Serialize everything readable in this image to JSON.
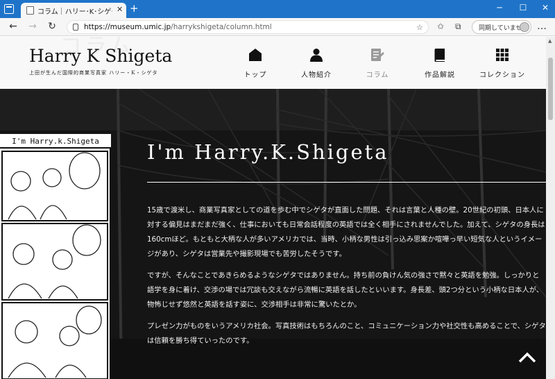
{
  "browser": {
    "tab_title": "コラム｜ハリー･K･シゲタ Harry K Shigeta",
    "tab_close": "✕",
    "new_tab": "+",
    "window_controls": {
      "minimize": "─",
      "maximize": "☐",
      "close": "✕"
    },
    "nav": {
      "back": "←",
      "forward": "→",
      "reload": "↻"
    },
    "url_host": "https://museum.umic.jp",
    "url_path": "/harrykshigeta/column.html",
    "sync_label": "同期していません",
    "more": "…"
  },
  "site": {
    "bg_word": "コラム",
    "logo": "Harry K Shigeta",
    "logo_sub": "上田が生んだ国際的商業写真家 ハリー・K・シゲタ",
    "nav": [
      {
        "label": "トップ",
        "icon": "home-icon"
      },
      {
        "label": "人物紹介",
        "icon": "person-icon"
      },
      {
        "label": "コラム",
        "icon": "edit-note-icon",
        "active": true
      },
      {
        "label": "作品解説",
        "icon": "book-icon"
      },
      {
        "label": "コレクション",
        "icon": "grid-icon"
      }
    ]
  },
  "column": {
    "comic_title": "I'm Harry.k.Shigeta",
    "heading": "I'm Harry.K.Shigeta",
    "paragraphs": [
      "15歳で渡米し、商業写真家としての道を歩む中でシゲタが直面した問題、それは言葉と人種の壁。20世紀の初頭、日本人に対する偏見はまだまだ強く、仕事においても日常会話程度の英語では全く相手にされませんでした。加えて、シゲタの身長は160cmほど。もともと大柄な人が多いアメリカでは、当時、小柄な男性は引っ込み思案か喧嘩っ早い短気な人というイメージがあり、シゲタは営業先や撮影現場でも苦労したそうです。",
      "ですが、そんなことであきらめるようなシゲタではありません。持ち前の負けん気の強さで黙々と英語を勉強。しっかりと語学を身に着け、交渉の場では冗談も交えながら流暢に英語を話したといいます。身長差、頭2つ分という小柄な日本人が、物怖じせず悠然と英語を話す姿に、交渉相手は非常に驚いたとか。",
      "プレゼン力がものをいうアメリカ社会。写真技術はもちろんのこと、コミュニケーション力や社交性も高めることで、シゲタは信頼を勝ち得ていったのです。"
    ]
  },
  "colors": {
    "titlebar": "#1f74c9",
    "dark_bg": "#141414",
    "header_bg": "#f8f8f8"
  }
}
